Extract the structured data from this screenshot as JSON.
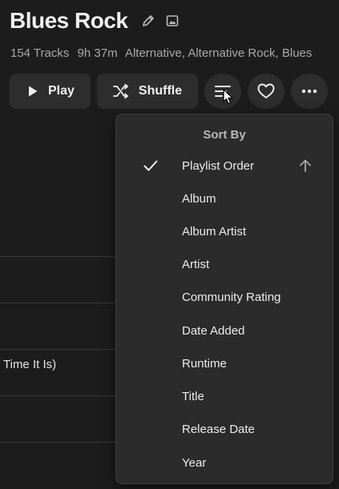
{
  "playlist": {
    "title": "Blues Rock",
    "track_count": "154 Tracks",
    "duration": "9h 37m",
    "genres": "Alternative, Alternative Rock, Blues"
  },
  "actions": {
    "play_label": "Play",
    "shuffle_label": "Shuffle"
  },
  "background_rows": {
    "partial_title": "Time It Is)"
  },
  "sort_menu": {
    "header": "Sort By",
    "selected": "Playlist Order",
    "items": [
      {
        "label": "Playlist Order",
        "selected": true,
        "direction_icon": "arrow-up-icon"
      },
      {
        "label": "Album"
      },
      {
        "label": "Album Artist"
      },
      {
        "label": "Artist"
      },
      {
        "label": "Community Rating"
      },
      {
        "label": "Date Added"
      },
      {
        "label": "Runtime"
      },
      {
        "label": "Title"
      },
      {
        "label": "Release Date"
      },
      {
        "label": "Year"
      }
    ]
  },
  "icons": {
    "edit": "pencil-icon",
    "image": "image-icon",
    "play": "play-icon",
    "shuffle": "shuffle-icon",
    "sort": "sort-icon",
    "favorite": "heart-icon",
    "more": "more-horizontal-icon",
    "check": "checkmark-icon"
  },
  "colors": {
    "background": "#1c1c1c",
    "button": "#2d2d2d",
    "menu": "#2b2b2b",
    "text": "#e8e8e8",
    "muted": "#a9a9a9"
  }
}
